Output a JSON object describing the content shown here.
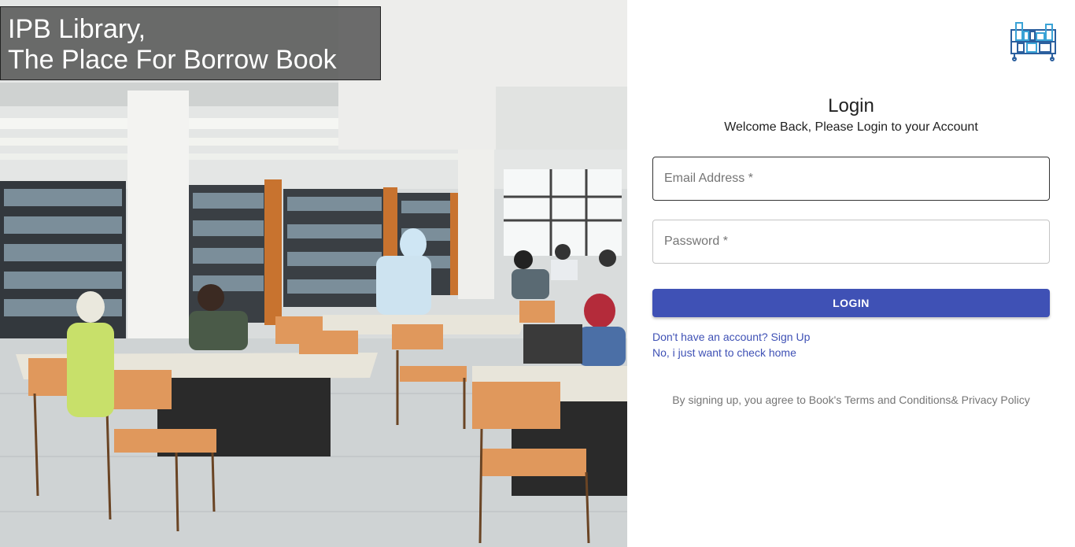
{
  "hero": {
    "title_line1": "IPB Library,",
    "title_line2": "The Place For Borrow Book"
  },
  "login": {
    "logo_icon": "bookshelf-icon",
    "title": "Login",
    "subtitle": "Welcome Back, Please Login to your Account",
    "email_placeholder": "Email Address *",
    "password_placeholder": "Password *",
    "button_label": "LOGIN",
    "signup_link": "Don't have an account? Sign Up",
    "home_link": "No, i just want to check home",
    "terms_text": "By signing up, you agree to Book's Terms and Conditions& Privacy Policy"
  },
  "colors": {
    "primary": "#3f51b5",
    "text": "#212121",
    "muted": "#757575"
  }
}
